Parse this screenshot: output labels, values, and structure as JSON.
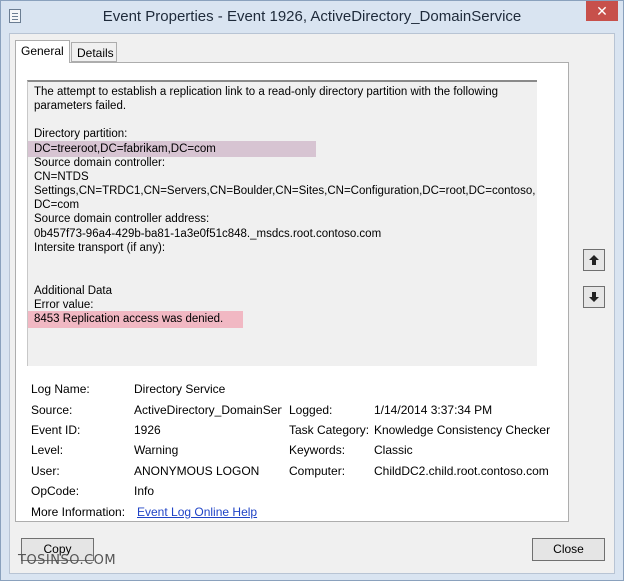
{
  "window": {
    "title": "Event Properties - Event 1926, ActiveDirectory_DomainService",
    "close_glyph": "✕"
  },
  "tabs": [
    {
      "label": "General",
      "selected": true
    },
    {
      "label": "Details",
      "selected": false
    }
  ],
  "description": {
    "lines": [
      "The attempt to establish a replication link to a read-only directory partition with the following",
      "parameters failed.",
      "",
      "Directory partition:",
      "DC=treeroot,DC=fabrikam,DC=com",
      "Source domain controller:",
      "CN=NTDS",
      "Settings,CN=TRDC1,CN=Servers,CN=Boulder,CN=Sites,CN=Configuration,DC=root,DC=contoso,",
      "DC=com",
      "Source domain controller address:",
      "0b457f73-96a4-429b-ba81-1a3e0f51c848._msdcs.root.contoso.com",
      "Intersite transport (if any):",
      "",
      "",
      "Additional Data",
      "Error value:",
      "8453 Replication access was denied."
    ]
  },
  "fields": {
    "log_name": {
      "label": "Log Name:",
      "value": "Directory Service"
    },
    "source": {
      "label": "Source:",
      "value": "ActiveDirectory_DomainServ"
    },
    "logged": {
      "label": "Logged:",
      "value": "1/14/2014 3:37:34 PM"
    },
    "event_id": {
      "label": "Event ID:",
      "value": "1926"
    },
    "task_category": {
      "label": "Task Category:",
      "value": "Knowledge Consistency Checker"
    },
    "level": {
      "label": "Level:",
      "value": "Warning"
    },
    "keywords": {
      "label": "Keywords:",
      "value": "Classic"
    },
    "user": {
      "label": "User:",
      "value": "ANONYMOUS LOGON"
    },
    "computer": {
      "label": "Computer:",
      "value": "ChildDC2.child.root.contoso.com"
    },
    "opcode": {
      "label": "OpCode:",
      "value": "Info"
    },
    "more_info": {
      "label": "More Information:",
      "link": "Event Log Online Help"
    }
  },
  "buttons": {
    "copy": "Copy",
    "close": "Close"
  },
  "watermark": "TOSINSO.COM",
  "colors": {
    "highlight_partition": "#d7c4d2",
    "highlight_error": "#f1b8c3",
    "close_button": "#c7504b",
    "link": "#1f43c6"
  }
}
